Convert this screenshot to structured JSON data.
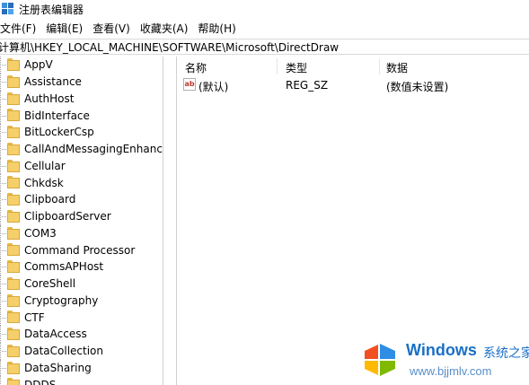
{
  "window": {
    "title": "注册表编辑器"
  },
  "menu": [
    {
      "label": "文件(F)"
    },
    {
      "label": "编辑(E)"
    },
    {
      "label": "查看(V)"
    },
    {
      "label": "收藏夹(A)"
    },
    {
      "label": "帮助(H)"
    }
  ],
  "address": {
    "path": "计算机\\HKEY_LOCAL_MACHINE\\SOFTWARE\\Microsoft\\DirectDraw"
  },
  "tree": {
    "items": [
      {
        "label": "AppV"
      },
      {
        "label": "Assistance"
      },
      {
        "label": "AuthHost"
      },
      {
        "label": "BidInterface"
      },
      {
        "label": "BitLockerCsp"
      },
      {
        "label": "CallAndMessagingEnhancer"
      },
      {
        "label": "Cellular"
      },
      {
        "label": "Chkdsk"
      },
      {
        "label": "Clipboard"
      },
      {
        "label": "ClipboardServer"
      },
      {
        "label": "COM3"
      },
      {
        "label": "Command Processor"
      },
      {
        "label": "CommsAPHost"
      },
      {
        "label": "CoreShell"
      },
      {
        "label": "Cryptography"
      },
      {
        "label": "CTF"
      },
      {
        "label": "DataAccess"
      },
      {
        "label": "DataCollection"
      },
      {
        "label": "DataSharing"
      },
      {
        "label": "DDDS"
      }
    ]
  },
  "values": {
    "columns": {
      "name": "名称",
      "type": "类型",
      "data": "数据"
    },
    "rows": [
      {
        "icon": "ab",
        "name": "(默认)",
        "type": "REG_SZ",
        "data": "(数值未设置)"
      }
    ]
  },
  "watermark": {
    "brand": "Windows",
    "cn": "系统之家",
    "url": "www.bjjmlv.com"
  },
  "colors": {
    "folder": "#f5cf6a",
    "watermark_blue": "#1a6fc7"
  }
}
